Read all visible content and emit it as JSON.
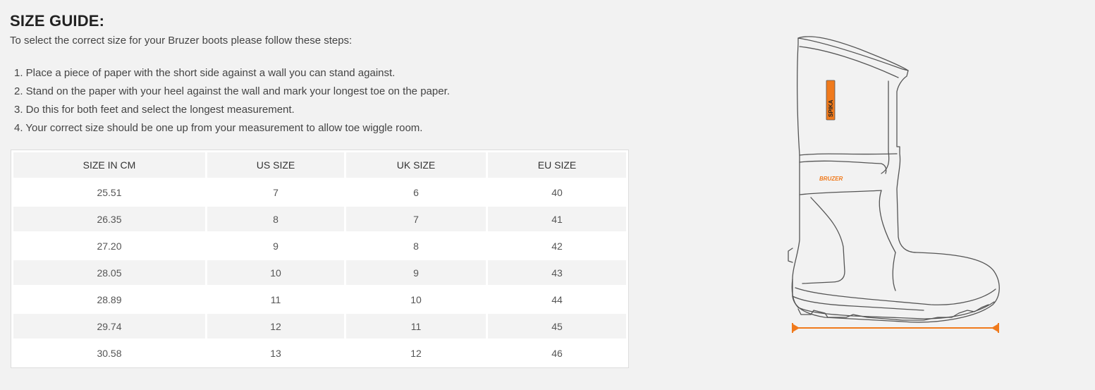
{
  "guide": {
    "title": "SIZE GUIDE:",
    "intro": "To select the correct size for your Bruzer boots please follow these steps:",
    "steps": [
      "1. Place a piece of paper with the short side against a wall you can stand against.",
      "2. Stand on the paper with your heel against the wall and mark your longest toe on the paper.",
      "3. Do this for both feet and select the longest measurement.",
      "4. Your correct size should be one up from your measurement to allow toe wiggle room."
    ]
  },
  "table": {
    "headers": [
      "SIZE IN CM",
      "US SIZE",
      "UK SIZE",
      "EU SIZE"
    ],
    "rows": [
      [
        "25.51",
        "7",
        "6",
        "40"
      ],
      [
        "26.35",
        "8",
        "7",
        "41"
      ],
      [
        "27.20",
        "9",
        "8",
        "42"
      ],
      [
        "28.05",
        "10",
        "9",
        "43"
      ],
      [
        "28.89",
        "11",
        "10",
        "44"
      ],
      [
        "29.74",
        "12",
        "11",
        "45"
      ],
      [
        "30.58",
        "13",
        "12",
        "46"
      ]
    ]
  },
  "illustration": {
    "shaft_label": "SPIKA",
    "band_label": "BRUZER",
    "accent_color": "#f07a1c",
    "line_color": "#555555"
  }
}
